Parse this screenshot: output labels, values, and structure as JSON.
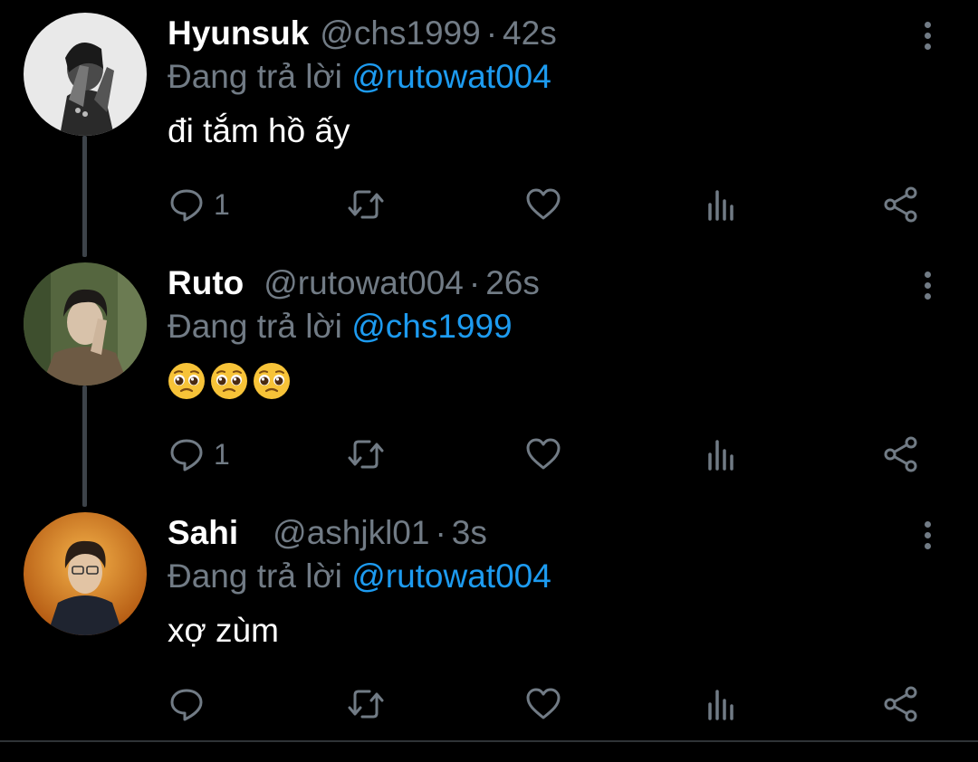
{
  "tweets": [
    {
      "name": "Hyunsuk",
      "handle": "@chs1999",
      "time": "42s",
      "reply_prefix": "Đang trả lời",
      "reply_to": "@rutowat004",
      "text": "đi tắm hồ ấy",
      "reply_count": "1"
    },
    {
      "name": "Ruto",
      "handle": "@rutowat004",
      "time": "26s",
      "reply_prefix": "Đang trả lời",
      "reply_to": "@chs1999",
      "text": "",
      "emoji": [
        "pleading-face",
        "pleading-face",
        "pleading-face"
      ],
      "reply_count": "1"
    },
    {
      "name": "Sahi",
      "handle": "@ashjkl01",
      "time": "3s",
      "reply_prefix": "Đang trả lời",
      "reply_to": "@rutowat004",
      "text": "xợ zùm",
      "reply_count": ""
    }
  ],
  "separator": "·",
  "colors": {
    "background": "#000000",
    "secondary_text": "#717b85",
    "mention": "#1d9bf0",
    "thread_line": "#3d4349"
  },
  "icons": [
    "reply-icon",
    "retweet-icon",
    "like-icon",
    "analytics-icon",
    "share-icon",
    "more-icon"
  ]
}
